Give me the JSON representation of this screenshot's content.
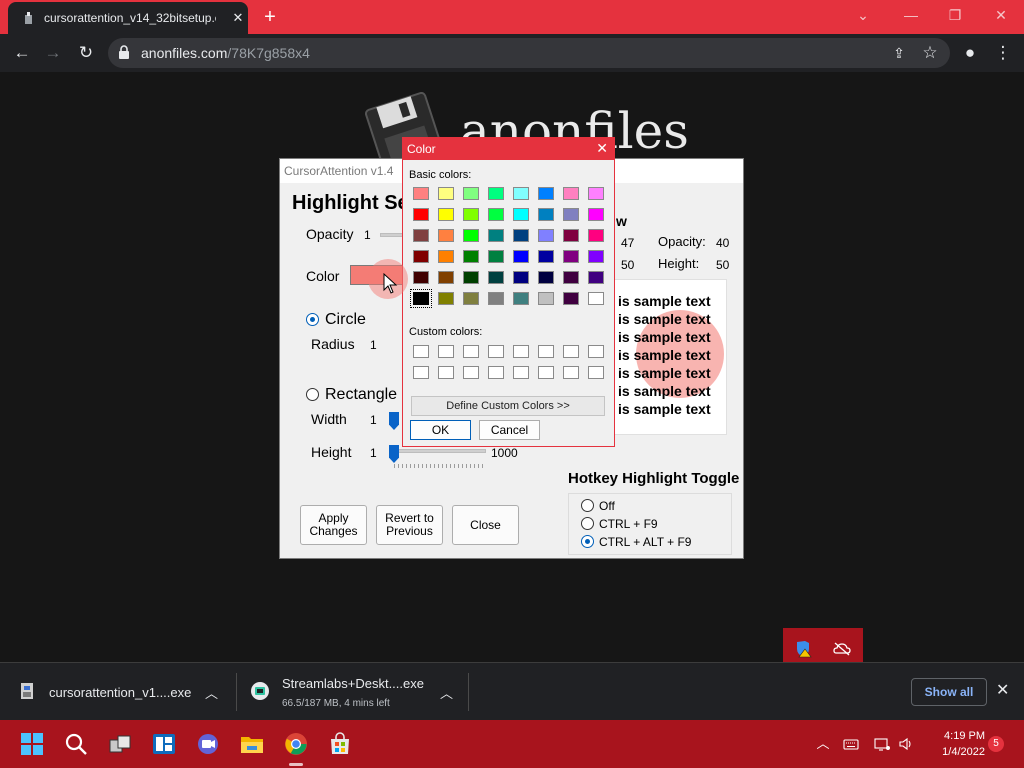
{
  "browser": {
    "tab_title": "cursorattention_v14_32bitsetup.e",
    "url_host": "anonfiles.com",
    "url_path": "/78K7g858x4"
  },
  "site": {
    "name": "anonfiles"
  },
  "app": {
    "window_title": "CursorAttention v1.4",
    "heading": "Highlight Se",
    "opacity_label": "Opacity",
    "opacity_value": "1",
    "color_label": "Color",
    "circle_label": "Circle",
    "radius_label": "Radius",
    "radius_value": "1",
    "rectangle_label": "Rectangle",
    "width_label": "Width",
    "width_value": "1",
    "height_label": "Height",
    "height_value": "1",
    "height_max": "1000",
    "preview_title_fragment": "w",
    "preview_left_value1": "47",
    "preview_left_value2": "50",
    "preview_opacity_label": "Opacity:",
    "preview_opacity_value": "40",
    "preview_height_label": "Height:",
    "preview_height_value": "50",
    "sample_text": "is sample text",
    "buttons": {
      "apply": "Apply\nChanges",
      "revert": "Revert to\nPrevious",
      "close": "Close"
    },
    "hotkey_title": "Hotkey Highlight Toggle",
    "hotkey_options": [
      "Off",
      "CTRL + F9",
      "CTRL + ALT + F9"
    ],
    "hotkey_selected": 2
  },
  "color_dialog": {
    "title": "Color",
    "basic_label": "Basic colors:",
    "custom_label": "Custom colors:",
    "define_button": "Define Custom Colors >>",
    "ok_button": "OK",
    "cancel_button": "Cancel",
    "basic_colors": [
      [
        "#ff8080",
        "#ffff80",
        "#80ff80",
        "#00ff80",
        "#80ffff",
        "#0080ff",
        "#ff80c0",
        "#ff80ff"
      ],
      [
        "#ff0000",
        "#ffff00",
        "#80ff00",
        "#00ff40",
        "#00ffff",
        "#0080c0",
        "#8080c0",
        "#ff00ff"
      ],
      [
        "#804040",
        "#ff8040",
        "#00ff00",
        "#008080",
        "#004080",
        "#8080ff",
        "#800040",
        "#ff0080"
      ],
      [
        "#800000",
        "#ff8000",
        "#008000",
        "#008040",
        "#0000ff",
        "#0000a0",
        "#800080",
        "#8000ff"
      ],
      [
        "#400000",
        "#804000",
        "#004000",
        "#004040",
        "#000080",
        "#000040",
        "#400040",
        "#400080"
      ],
      [
        "#000000",
        "#808000",
        "#808040",
        "#808080",
        "#408080",
        "#c0c0c0",
        "#400040",
        "#ffffff"
      ]
    ],
    "selected_index": [
      5,
      0
    ]
  },
  "downloads": [
    {
      "name": "cursorattention_v1....exe",
      "status": ""
    },
    {
      "name": "Streamlabs+Deskt....exe",
      "status": "66.5/187 MB, 4 mins left"
    }
  ],
  "downloads_show_all": "Show all",
  "taskbar": {
    "time": "4:19 PM",
    "date": "1/4/2022",
    "notifications": "5"
  },
  "colors": {
    "accent_red": "#e5323e",
    "taskbar_red": "#a8141d",
    "highlight_color": "#f47c75"
  }
}
